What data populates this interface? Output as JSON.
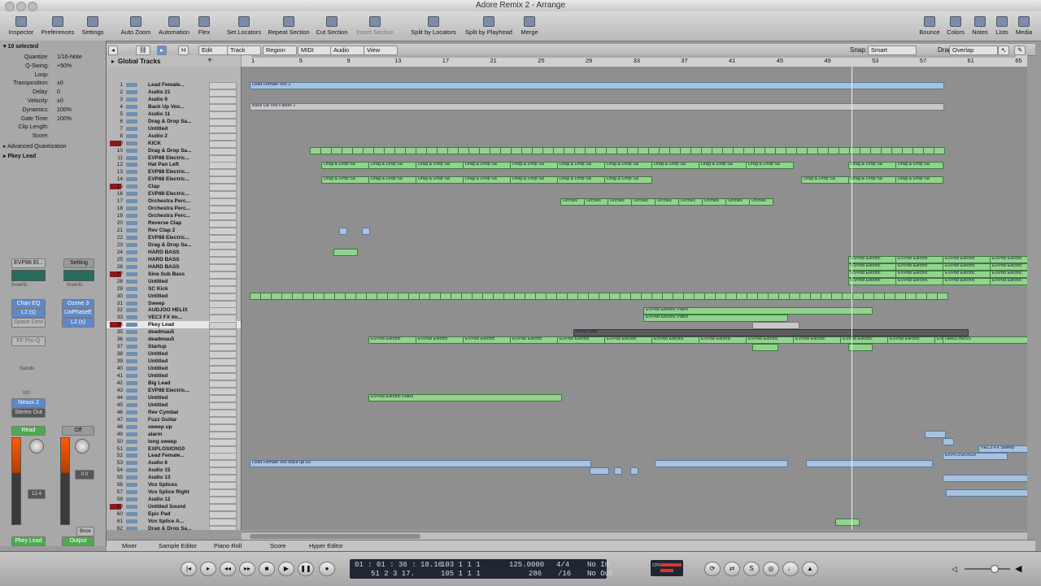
{
  "window": {
    "title": "Adore Remix 2 - Arrange"
  },
  "toolbar": {
    "left": [
      "Inspector",
      "Preferences",
      "Settings"
    ],
    "tools": [
      "Auto Zoom",
      "Automation",
      "Flex"
    ],
    "locators": [
      "Set Locators",
      "Repeat Section",
      "Cut Section",
      "Insert Section"
    ],
    "split": [
      "Split by Locators",
      "Split by Playhead",
      "Merge"
    ],
    "right": [
      "Bounce",
      "Colors",
      "Notes",
      "Lists",
      "Media"
    ]
  },
  "inspector": {
    "selected": "10 selected",
    "params": [
      {
        "k": "Quantize:",
        "v": "1/16-Note"
      },
      {
        "k": "Q-Swing:",
        "v": "+50%"
      },
      {
        "k": "Loop:",
        "v": ""
      },
      {
        "k": "Transposition:",
        "v": "±0"
      },
      {
        "k": "Delay:",
        "v": "0"
      },
      {
        "k": "Velocity:",
        "v": "±0"
      },
      {
        "k": "Dynamics:",
        "v": "100%"
      },
      {
        "k": "Gate Time:",
        "v": "100%"
      },
      {
        "k": "Clip Length:",
        "v": ""
      },
      {
        "k": "Score:",
        "v": ""
      }
    ],
    "adv": "Advanced Quantization",
    "track": "Pkey Lead",
    "ch1": {
      "instrument": "EVP88 El...",
      "setting": "Setting",
      "inserts": "Inserts",
      "ins": [
        "Chan EQ",
        "L2 (s)",
        "Space Desi",
        "FF Pro-Q"
      ],
      "sends": "Sends",
      "send1": "Nexus 2",
      "io": "I/O",
      "out": "Stereo Out",
      "mode": "Read",
      "name": "Pkey Lead"
    },
    "ch2": {
      "inserts": "Inserts",
      "ins": [
        "Ozone 3",
        "LinPhaseE",
        "L2 (s)"
      ],
      "mode": "Off",
      "name": "Output",
      "pan": "0.0",
      "vol": "12.4"
    },
    "bnce": "Bnce"
  },
  "arrange": {
    "menus": [
      "Edit",
      "Track",
      "Region",
      "MIDI",
      "Audio",
      "View"
    ],
    "snap_label": "Snap:",
    "snap": "Smart",
    "drag_label": "Drag:",
    "drag": "Overlap",
    "global": "Global Tracks",
    "bars": [
      "1",
      "5",
      "9",
      "13",
      "17",
      "21",
      "25",
      "29",
      "33",
      "37",
      "41",
      "45",
      "49",
      "53",
      "57",
      "61",
      "65"
    ]
  },
  "tracks": [
    {
      "n": "1",
      "name": "Lead Female..."
    },
    {
      "n": "2",
      "name": "Audio 21"
    },
    {
      "n": "3",
      "name": "Audio 9"
    },
    {
      "n": "4",
      "name": "Back Up Vox..."
    },
    {
      "n": "5",
      "name": "Audio 11"
    },
    {
      "n": "6",
      "name": "Drag & Drop Sa..."
    },
    {
      "n": "7",
      "name": "Untitled"
    },
    {
      "n": "8",
      "name": "Audio 2"
    },
    {
      "n": "9",
      "name": "KICK"
    },
    {
      "n": "10",
      "name": "Drag & Drop Sa..."
    },
    {
      "n": "11",
      "name": "EVP88 Electric..."
    },
    {
      "n": "12",
      "name": "Hat Pan Left"
    },
    {
      "n": "13",
      "name": "EVP88 Electric..."
    },
    {
      "n": "14",
      "name": "EVP88 Electric..."
    },
    {
      "n": "15",
      "name": "Clap"
    },
    {
      "n": "16",
      "name": "EVP88 Electric..."
    },
    {
      "n": "17",
      "name": "Orchestra Perc..."
    },
    {
      "n": "18",
      "name": "Orchestra Perc..."
    },
    {
      "n": "19",
      "name": "Orchestra Perc..."
    },
    {
      "n": "20",
      "name": "Reverse Clap"
    },
    {
      "n": "21",
      "name": "Rev Clap 2"
    },
    {
      "n": "22",
      "name": "EVP88 Electric..."
    },
    {
      "n": "23",
      "name": "Drag & Drop Sa..."
    },
    {
      "n": "24",
      "name": "HARD BASS"
    },
    {
      "n": "25",
      "name": "HARD BASS"
    },
    {
      "n": "26",
      "name": "HARD BASS"
    },
    {
      "n": "27",
      "name": "Sine Sub Bass"
    },
    {
      "n": "28",
      "name": "Untitled"
    },
    {
      "n": "29",
      "name": "SC Kick"
    },
    {
      "n": "30",
      "name": "Untitled"
    },
    {
      "n": "31",
      "name": "Sweep"
    },
    {
      "n": "32",
      "name": "AUDJOO HELIX"
    },
    {
      "n": "33",
      "name": "VEC3 FX Im..."
    },
    {
      "n": "34",
      "name": "Pkey Lead"
    },
    {
      "n": "35",
      "name": "deadmau5"
    },
    {
      "n": "36",
      "name": "deadmau5"
    },
    {
      "n": "37",
      "name": "Startup"
    },
    {
      "n": "38",
      "name": "Untitled"
    },
    {
      "n": "39",
      "name": "Untitled"
    },
    {
      "n": "40",
      "name": "Untitled"
    },
    {
      "n": "41",
      "name": "Untitled"
    },
    {
      "n": "42",
      "name": "Big Lead"
    },
    {
      "n": "43",
      "name": "EVP88 Electric..."
    },
    {
      "n": "44",
      "name": "Untitled"
    },
    {
      "n": "45",
      "name": "Untitled"
    },
    {
      "n": "46",
      "name": "Rev Cymbal"
    },
    {
      "n": "47",
      "name": "Fuzz Guitar"
    },
    {
      "n": "48",
      "name": "sweep up"
    },
    {
      "n": "49",
      "name": "alarm"
    },
    {
      "n": "50",
      "name": "long sweep"
    },
    {
      "n": "51",
      "name": "EXPLOSION10"
    },
    {
      "n": "52",
      "name": "Lead Female..."
    },
    {
      "n": "53",
      "name": "Audio 6"
    },
    {
      "n": "54",
      "name": "Audio 15"
    },
    {
      "n": "55",
      "name": "Audio 13"
    },
    {
      "n": "56",
      "name": "Vox Splices"
    },
    {
      "n": "57",
      "name": "Vox Splice Right"
    },
    {
      "n": "58",
      "name": "Audio 12"
    },
    {
      "n": "59",
      "name": "Untitled Sound"
    },
    {
      "n": "60",
      "name": "Epic Pad"
    },
    {
      "n": "61",
      "name": "Vox Splice A..."
    },
    {
      "n": "62",
      "name": "Drag & Drop Sa..."
    }
  ],
  "region_labels": {
    "lead": "Lead Female Vox 2",
    "backup": "Back Up Vox Faster 2",
    "drop": "Drag & Drop Sa",
    "orch": "Orches",
    "evp": "EVP88 Electric",
    "evp_piano": "EVP88 Electric Piano",
    "pkey": "Pkey Lead",
    "hard": "HARD BASS",
    "backrun": "Lead Female Vox Back up 60",
    "vec3": "VEC3 FX Sweep",
    "explo": "EXPLOSION10"
  },
  "bottom_tabs": [
    "Mixer",
    "Sample Editor",
    "Piano Roll",
    "Score",
    "Hyper Editor"
  ],
  "transport": {
    "smpte": "01 : 01 : 36 : 18.16",
    "pos": "51  2  3  17.",
    "bars1": "103  1  1  1",
    "bars2": "105  1  1  1",
    "tempo": "125.0000",
    "tempo2": "286",
    "sig": "4/4",
    "div": "/16",
    "in": "No In",
    "out": "No Out",
    "cpu": "CPU"
  },
  "colors": {
    "region_green": "#93d28f",
    "region_blue": "#a6c2e0",
    "lcd": "#202632",
    "kick_red": "#8b1a1a"
  }
}
